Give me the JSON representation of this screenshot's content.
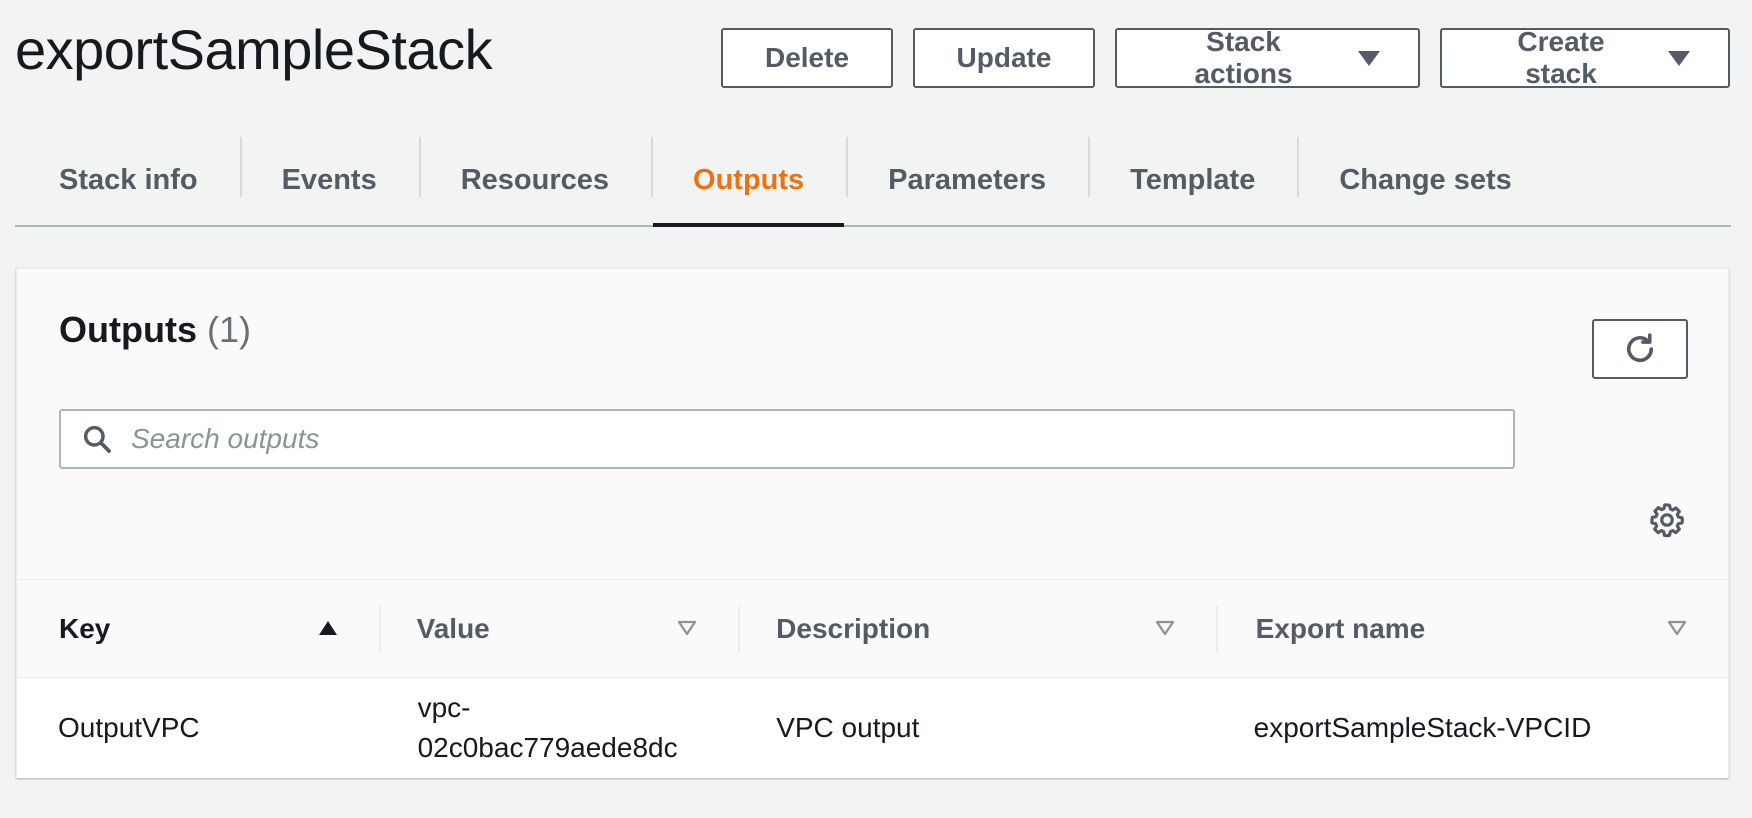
{
  "page": {
    "title": "exportSampleStack"
  },
  "header_actions": {
    "delete_label": "Delete",
    "update_label": "Update",
    "stack_actions_label": "Stack actions",
    "create_stack_label": "Create stack"
  },
  "tabs": [
    {
      "label": "Stack info",
      "active": false
    },
    {
      "label": "Events",
      "active": false
    },
    {
      "label": "Resources",
      "active": false
    },
    {
      "label": "Outputs",
      "active": true
    },
    {
      "label": "Parameters",
      "active": false
    },
    {
      "label": "Template",
      "active": false
    },
    {
      "label": "Change sets",
      "active": false
    }
  ],
  "outputs": {
    "title": "Outputs",
    "count": "(1)",
    "search": {
      "value": "",
      "placeholder": "Search outputs"
    },
    "columns": [
      {
        "label": "Key",
        "sort": "ascending"
      },
      {
        "label": "Value",
        "sort": "none"
      },
      {
        "label": "Description",
        "sort": "none"
      },
      {
        "label": "Export name",
        "sort": "none"
      }
    ],
    "rows": [
      {
        "key": "OutputVPC",
        "value": "vpc-02c0bac779aede8dc",
        "description": "VPC output",
        "export_name": "exportSampleStack-VPCID"
      }
    ]
  },
  "colors": {
    "accent": "#ec7211",
    "text": "#16191f",
    "muted": "#545b64",
    "background": "#f2f3f3"
  },
  "icons": {
    "refresh": "refresh-icon",
    "search": "search-icon",
    "settings": "gear-icon",
    "sort_ascending": "sort-ascending-icon",
    "sort_none": "sort-unsorted-icon",
    "dropdown": "caret-down-icon"
  }
}
